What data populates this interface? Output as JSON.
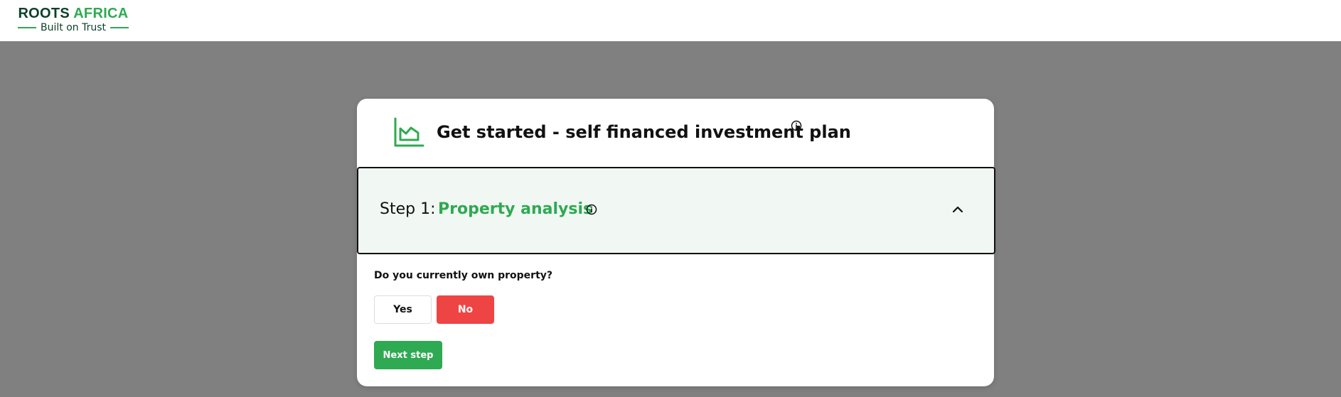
{
  "header": {
    "logo_primary": "ROOTS",
    "logo_accent": "AFRICA",
    "logo_tagline": "Built on Trust"
  },
  "card": {
    "title": "Get started - self financed investment plan",
    "title_icon": "chart-icon",
    "step": {
      "prefix": "Step 1:",
      "name": "Property analysis",
      "expanded": true
    },
    "question": "Do you currently own property?",
    "options": [
      {
        "label": "Yes",
        "selected": false
      },
      {
        "label": "No",
        "selected": true
      }
    ],
    "next_label": "Next step"
  },
  "colors": {
    "brand_green": "#2faa52",
    "brand_dark": "#0d3f2a",
    "selected_red": "#ef4444",
    "overlay": "#808080",
    "step_bg": "#f1f7f3"
  }
}
